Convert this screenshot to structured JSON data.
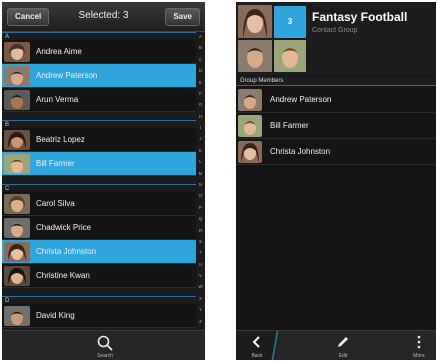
{
  "picker": {
    "cancel_label": "Cancel",
    "title": "Selected: 3",
    "save_label": "Save",
    "index_letters": [
      "A",
      "B",
      "C",
      "D",
      "E",
      "F",
      "G",
      "H",
      "I",
      "J",
      "K",
      "L",
      "M",
      "N",
      "O",
      "P",
      "Q",
      "R",
      "S",
      "T",
      "U",
      "V",
      "W",
      "X",
      "Y",
      "Z"
    ],
    "search_label": "Search",
    "sections": [
      {
        "letter": "A",
        "rows": [
          {
            "name": "Andrea Aime",
            "selected": false
          },
          {
            "name": "Andrew Paterson",
            "selected": true
          },
          {
            "name": "Arun Verma",
            "selected": false
          }
        ]
      },
      {
        "letter": "B",
        "rows": [
          {
            "name": "Beatriz Lopez",
            "selected": false
          },
          {
            "name": "Bill Farmer",
            "selected": true
          }
        ]
      },
      {
        "letter": "C",
        "rows": [
          {
            "name": "Carol Silva",
            "selected": false
          },
          {
            "name": "Chadwick Price",
            "selected": false
          },
          {
            "name": "Christa Johnston",
            "selected": true
          },
          {
            "name": "Christine Kwan",
            "selected": false
          }
        ]
      },
      {
        "letter": "D",
        "rows": [
          {
            "name": "David King",
            "selected": false
          }
        ]
      }
    ]
  },
  "group": {
    "count": "3",
    "title": "Fantasy Football",
    "subtitle": "Contact Group",
    "members_header": "Group Members",
    "members": [
      "Andrew Paterson",
      "Bill Farmer",
      "Christa Johnston"
    ],
    "back_label": "Back",
    "edit_label": "Edit",
    "more_label": "More"
  },
  "colors": {
    "accent": "#2ea5dc",
    "background": "#151515"
  }
}
